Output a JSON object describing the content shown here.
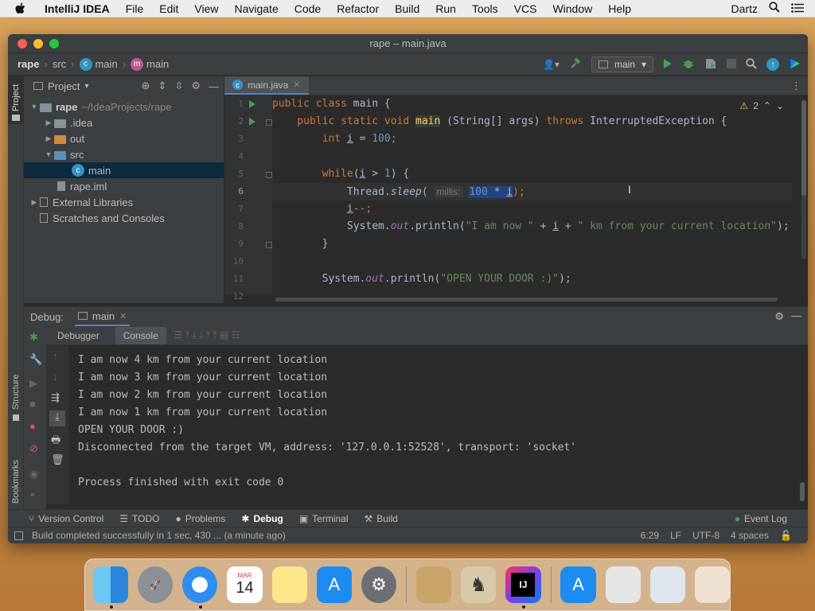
{
  "menubar": {
    "app_name": "IntelliJ IDEA",
    "items": [
      "File",
      "Edit",
      "View",
      "Navigate",
      "Code",
      "Refactor",
      "Build",
      "Run",
      "Tools",
      "VCS",
      "Window",
      "Help"
    ],
    "user": "Dartz"
  },
  "window": {
    "title": "rape – main.java"
  },
  "breadcrumb": {
    "project": "rape",
    "folder": "src",
    "class": "main",
    "method": "main"
  },
  "toolbar": {
    "run_config": "main"
  },
  "project_pane": {
    "title": "Project",
    "tree": [
      {
        "label": "rape",
        "path": "~/IdeaProjects/rape"
      },
      {
        "label": ".idea"
      },
      {
        "label": "out"
      },
      {
        "label": "src"
      },
      {
        "label": "main"
      },
      {
        "label": "rape.iml"
      },
      {
        "label": "External Libraries"
      },
      {
        "label": "Scratches and Consoles"
      }
    ]
  },
  "left_strip": {
    "project_label": "Project",
    "structure_label": "Structure",
    "bookmarks_label": "Bookmarks"
  },
  "editor": {
    "tab_label": "main.java",
    "warning_count": "2",
    "line_numbers": [
      "1",
      "2",
      "3",
      "4",
      "5",
      "6",
      "7",
      "8",
      "9",
      "10",
      "11",
      "12"
    ],
    "param_hint": "millis:",
    "lines": {
      "l1_a": "public class",
      "l1_b": " main {",
      "l2_a": "    public static void ",
      "l2_b": "main",
      "l2_c": " (String[] args) ",
      "l2_d": "throws",
      "l2_e": " InterruptedException {",
      "l3_a": "        int ",
      "l3_b": "i",
      "l3_c": " = ",
      "l3_d": "100",
      "l3_e": ";",
      "l5_a": "        while",
      "l5_b": "(",
      "l5_c": "i",
      "l5_d": " > ",
      "l5_e": "1",
      "l5_f": ") {",
      "l6_a": "            Thread.",
      "l6_b": "sleep",
      "l6_c": "( ",
      "l6_d": "100",
      "l6_e": " * ",
      "l6_f": "i",
      "l6_g": ");",
      "l7_a": "            ",
      "l7_b": "i",
      "l7_c": "--;",
      "l8_a": "            System.",
      "l8_b": "out",
      "l8_c": ".println(",
      "l8_d": "\"I am now \"",
      "l8_e": " + ",
      "l8_f": "i",
      "l8_g": " + ",
      "l8_h": "\" km from your current location\"",
      "l8_i": ");",
      "l9_a": "        }",
      "l11_a": "        System.",
      "l11_b": "out",
      "l11_c": ".println(",
      "l11_d": "\"OPEN YOUR DOOR :)\"",
      "l11_e": ");"
    }
  },
  "debug": {
    "label": "Debug:",
    "session_tab": "main",
    "tabs": [
      "Debugger",
      "Console"
    ],
    "console_lines": [
      "I am now 4 km from your current location",
      "I am now 3 km from your current location",
      "I am now 2 km from your current location",
      "I am now 1 km from your current location",
      "OPEN YOUR DOOR :)",
      "Disconnected from the target VM, address: '127.0.0.1:52528', transport: 'socket'",
      "",
      "Process finished with exit code 0"
    ]
  },
  "bottom_tools": {
    "items": [
      "Version Control",
      "TODO",
      "Problems",
      "Debug",
      "Terminal",
      "Build"
    ],
    "event_log": "Event Log"
  },
  "status": {
    "message": "Build completed successfully in 1 sec, 430 ... (a minute ago)",
    "position": "6:29",
    "line_sep": "LF",
    "encoding": "UTF-8",
    "indent": "4 spaces"
  },
  "dock": {
    "calendar_month": "MAR",
    "calendar_day": "14"
  },
  "colors": {
    "keyword": "#cc7832",
    "number": "#6897bb",
    "string": "#6a8759",
    "field": "#9876aa",
    "method_highlight": "#ffc66d",
    "selection": "#0d293e",
    "accent": "#4a88c7"
  }
}
